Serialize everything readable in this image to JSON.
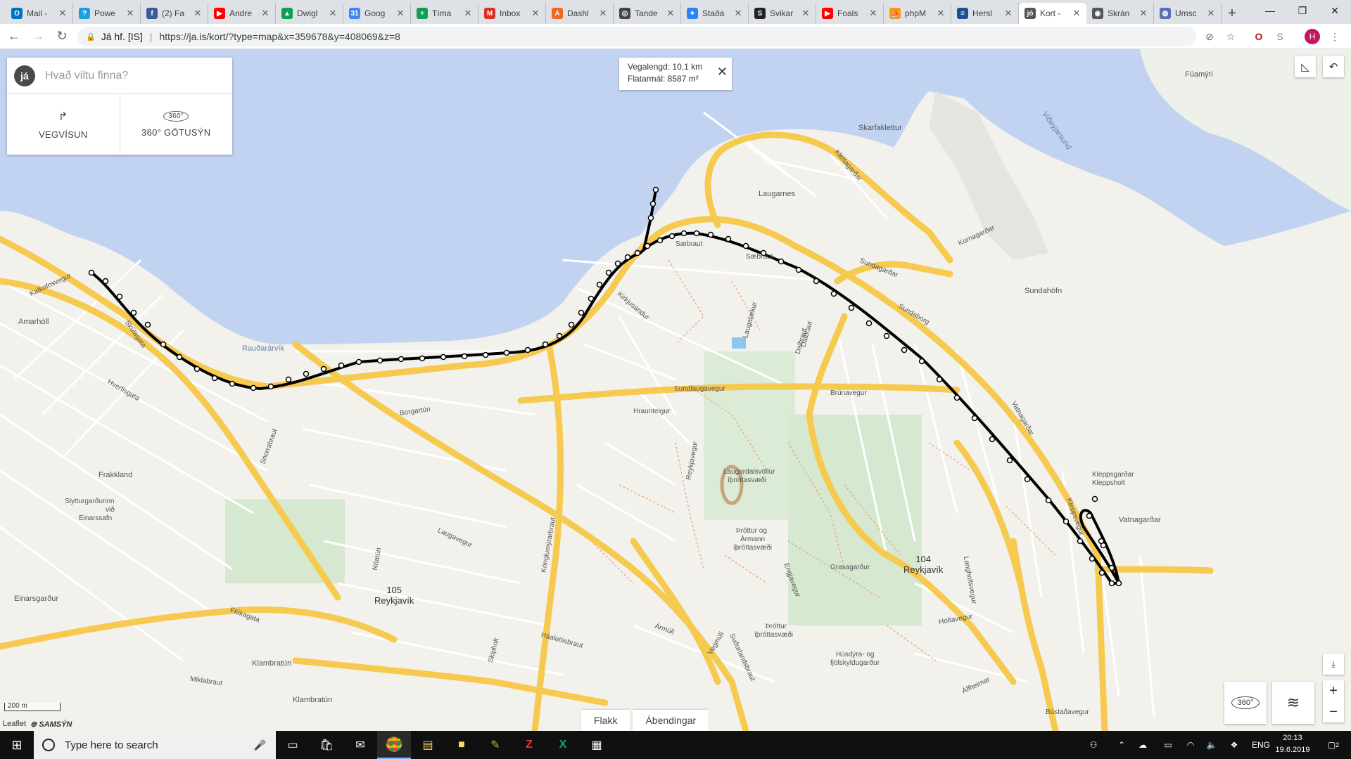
{
  "browser": {
    "tabs": [
      {
        "title": "Mail -",
        "color": "#0072c6",
        "glyph": "O"
      },
      {
        "title": "Powe",
        "color": "#1ba1e2",
        "glyph": "?"
      },
      {
        "title": "(2) Fa",
        "color": "#3b5998",
        "glyph": "f"
      },
      {
        "title": "Andre",
        "color": "#ff0000",
        "glyph": "▶"
      },
      {
        "title": "Dwigl",
        "color": "#0f9d58",
        "glyph": "▲"
      },
      {
        "title": "Goog",
        "color": "#4285f4",
        "glyph": "31"
      },
      {
        "title": "Tíma",
        "color": "#0f9d58",
        "glyph": "+"
      },
      {
        "title": "Inbox",
        "color": "#d93025",
        "glyph": "M"
      },
      {
        "title": "Dashl",
        "color": "#f26522",
        "glyph": "A"
      },
      {
        "title": "Tande",
        "color": "#444444",
        "glyph": "◎"
      },
      {
        "title": "Staða",
        "color": "#2684ff",
        "glyph": "✦"
      },
      {
        "title": "Svikar",
        "color": "#222222",
        "glyph": "S"
      },
      {
        "title": "Foals",
        "color": "#ff0000",
        "glyph": "▶"
      },
      {
        "title": "phpM",
        "color": "#f89c0e",
        "glyph": "⛵"
      },
      {
        "title": "Hersl",
        "color": "#1e4e9b",
        "glyph": "≡"
      },
      {
        "title": "Kort -",
        "color": "#555555",
        "glyph": "jó",
        "active": true
      },
      {
        "title": "Skrán",
        "color": "#555555",
        "glyph": "◉"
      },
      {
        "title": "Umsc",
        "color": "#5b6db5",
        "glyph": "◍"
      }
    ],
    "new_tab": "+",
    "window_controls": {
      "minimize": "—",
      "maximize": "❐",
      "close": "✕"
    },
    "nav": {
      "back": "←",
      "forward": "→",
      "reload": "↻"
    },
    "address": {
      "org": "Já hf. [IS]",
      "separator": "|",
      "url": "https://ja.is/kort/?type=map&x=359678&y=408069&z=8"
    },
    "profile_initial": "H"
  },
  "map": {
    "search": {
      "logo": "já",
      "placeholder": "Hvað viltu finna?"
    },
    "buttons": {
      "directions": {
        "icon": "↱",
        "label": "VEGVÍSUN"
      },
      "streetview": {
        "icon": "360°",
        "label": "360° GÖTUSÝN"
      }
    },
    "measure": {
      "distance": "Vegalengd: 10,1 km",
      "area": "Flatarmál: 8587 m²",
      "close": "✕"
    },
    "bottom_tabs": [
      "Flakk",
      "Ábendingar"
    ],
    "scale": "200 m",
    "attribution": {
      "leaflet": "Leaflet",
      "samsyn": "SAMSÝN"
    },
    "zoom": {
      "in": "+",
      "out": "−"
    },
    "side_360": "360°",
    "labels": {
      "sea": [
        "Rauðarárvík",
        "Viðeyjarsund"
      ],
      "districts": [
        {
          "num": "105",
          "name": "Reykjavík"
        },
        {
          "num": "104",
          "name": "Reykjavík"
        }
      ],
      "places": [
        "Fúamýri",
        "Skarfaklettur",
        "Laugarnes",
        "Sundahöfn",
        "Kleppsgarðar",
        "Kleppsholt",
        "Vatnagarðar",
        "Amarhóll",
        "Frakkland",
        "Einarsgarður",
        "Klambratún",
        "Klambratún",
        "Laugardalsvöllur",
        "íþróttasvæði",
        "Þróttur og",
        "Ármann",
        "íþróttasvæði",
        "Grasagarður",
        "Þróttur",
        "íþróttasvæði",
        "Húsdýra- og",
        "fjölskyldugarður",
        "Slytturgarðurinn",
        "við",
        "Einarssafn"
      ],
      "streets": [
        "Kalkofnsvegur",
        "Skúlagata",
        "Sæbraut",
        "Sundagarðar",
        "Kleppsvegur",
        "Borgartún",
        "Sundlaugavegur",
        "Brúnavegur",
        "Laugavegur",
        "Hverfisgata",
        "Snorrabraut",
        "Kringlumýrarbraut",
        "Miklabraut",
        "Háaleitisbraut",
        "Skipholt",
        "Reykjavegur",
        "Engjavegur",
        "Suðurlandsbraut",
        "Holtavegur",
        "Langholtsvegur",
        "Dalbraut",
        "Kirkjusandur",
        "Hraunteigur",
        "Nóatún",
        "Flókagata",
        "Vatnagarðar",
        "Álfheimar",
        "Bústaðavegur",
        "Vegmúli",
        "Ármúli",
        "Laugalækur",
        "Klettagarðar",
        "Kornagarðar",
        "Sundaborg",
        "Dalbraut",
        "Sæbraut"
      ]
    }
  },
  "taskbar": {
    "start": "⊞",
    "search_placeholder": "Type here to search",
    "time": "20:13",
    "date": "19.6.2019",
    "lang": "ENG",
    "notif": "2"
  }
}
